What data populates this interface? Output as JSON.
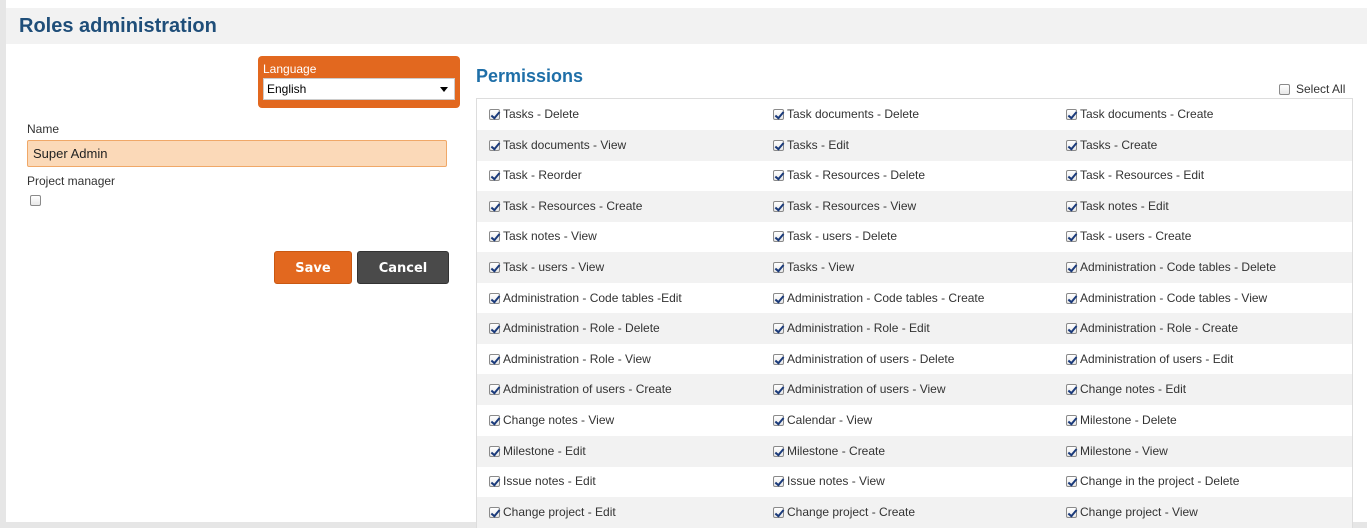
{
  "header": {
    "title": "Roles administration"
  },
  "form": {
    "language_label": "Language",
    "language_value": "English",
    "name_label": "Name",
    "name_value": "Super Admin",
    "project_manager_label": "Project manager",
    "project_manager_checked": false,
    "save_label": "Save",
    "cancel_label": "Cancel"
  },
  "permissions": {
    "title": "Permissions",
    "select_all_label": "Select All",
    "rows": [
      [
        "Tasks - Delete",
        "Task documents - Delete",
        "Task documents - Create"
      ],
      [
        "Task documents - View",
        "Tasks - Edit",
        "Tasks - Create"
      ],
      [
        "Task - Reorder",
        "Task - Resources - Delete",
        "Task - Resources - Edit"
      ],
      [
        "Task - Resources - Create",
        "Task - Resources - View",
        "Task notes - Edit"
      ],
      [
        "Task notes - View",
        "Task - users - Delete",
        "Task - users - Create"
      ],
      [
        "Task - users - View",
        "Tasks - View",
        "Administration - Code tables - Delete"
      ],
      [
        "Administration - Code tables -Edit",
        "Administration - Code tables - Create",
        "Administration - Code tables - View"
      ],
      [
        "Administration - Role - Delete",
        "Administration - Role - Edit",
        "Administration - Role - Create"
      ],
      [
        "Administration - Role - View",
        "Administration of users - Delete",
        "Administration of users - Edit"
      ],
      [
        "Administration of users - Create",
        "Administration of users - View",
        "Change notes - Edit"
      ],
      [
        "Change notes - View",
        "Calendar - View",
        "Milestone - Delete"
      ],
      [
        "Milestone - Edit",
        "Milestone - Create",
        "Milestone - View"
      ],
      [
        "Issue notes - Edit",
        "Issue notes - View",
        "Change in the project - Delete"
      ],
      [
        "Change project - Edit",
        "Change project - Create",
        "Change project - View"
      ]
    ]
  }
}
